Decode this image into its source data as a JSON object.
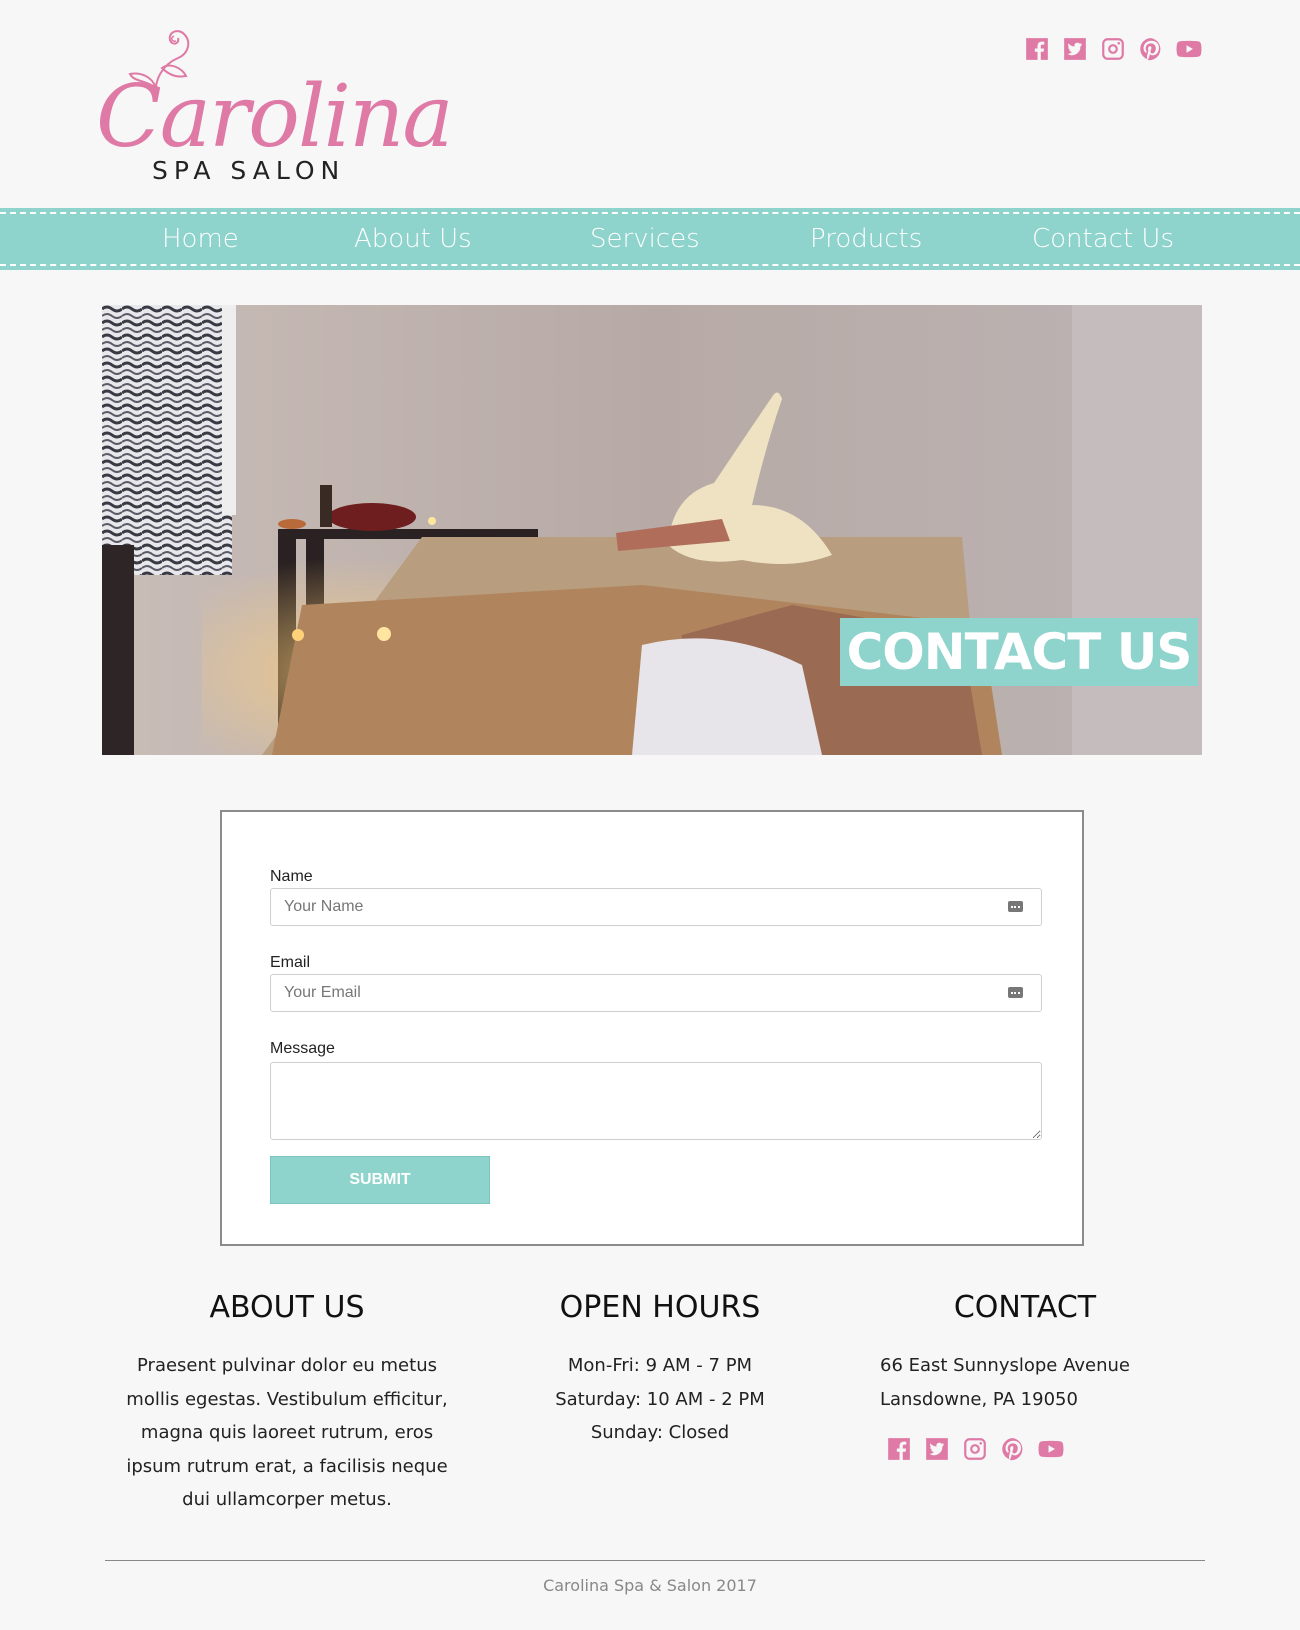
{
  "brand": {
    "script": "Carolina",
    "subtitle": "SPA SALON",
    "accent_color": "#de7aa5",
    "nav_color": "#8ed3cc"
  },
  "social_icons": [
    "facebook-icon",
    "twitter-icon",
    "instagram-icon",
    "pinterest-icon",
    "youtube-icon"
  ],
  "nav": {
    "items": [
      {
        "label": "Home"
      },
      {
        "label": "About Us"
      },
      {
        "label": "Services"
      },
      {
        "label": "Products"
      },
      {
        "label": "Contact Us"
      }
    ]
  },
  "hero": {
    "label": "CONTACT US"
  },
  "form": {
    "name_label": "Name",
    "name_placeholder": "Your Name",
    "email_label": "Email",
    "email_placeholder": "Your Email",
    "message_label": "Message",
    "submit_label": "SUBMIT"
  },
  "footer": {
    "about": {
      "title": "ABOUT US",
      "text": "Praesent pulvinar dolor eu metus mollis egestas. Vestibulum efficitur, magna quis laoreet rutrum, eros ipsum rutrum erat, a facilisis neque dui ullamcorper metus."
    },
    "hours": {
      "title": "OPEN HOURS",
      "lines": [
        "Mon-Fri: 9 AM - 7 PM",
        "Saturday: 10 AM - 2 PM",
        "Sunday: Closed"
      ]
    },
    "contact": {
      "title": "CONTACT",
      "lines": [
        "66 East Sunnyslope Avenue",
        "Lansdowne, PA 19050"
      ]
    },
    "copyright": "Carolina Spa & Salon 2017"
  }
}
